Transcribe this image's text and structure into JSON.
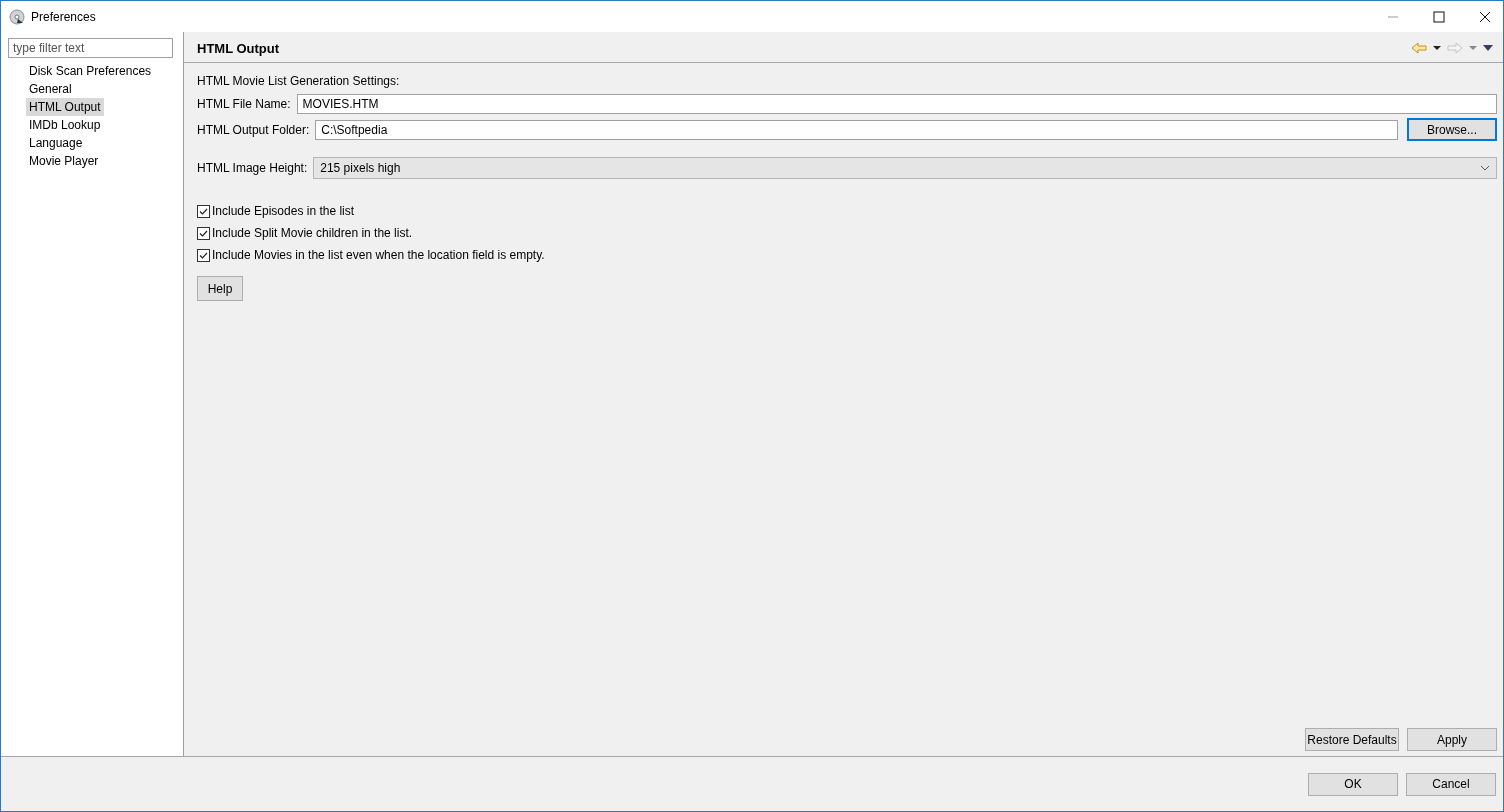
{
  "window": {
    "title": "Preferences"
  },
  "sidebar": {
    "filter": {
      "placeholder": "type filter text"
    },
    "items": [
      {
        "label": "Disk Scan Preferences",
        "selected": false
      },
      {
        "label": "General",
        "selected": false
      },
      {
        "label": "HTML Output",
        "selected": true
      },
      {
        "label": "IMDb Lookup",
        "selected": false
      },
      {
        "label": "Language",
        "selected": false
      },
      {
        "label": "Movie Player",
        "selected": false
      }
    ]
  },
  "page": {
    "title": "HTML Output",
    "section_heading": "HTML Movie List Generation Settings:",
    "file_name": {
      "label": "HTML File Name:",
      "value": "MOVIES.HTM"
    },
    "output_folder": {
      "label": "HTML Output Folder:",
      "value": "C:\\Softpedia",
      "button": {
        "label": "Browse...",
        "focused": true
      }
    },
    "image_height": {
      "label": "HTML Image Height:",
      "value": "215 pixels high"
    },
    "checkboxes": [
      {
        "label": "Include Episodes in the list",
        "checked": true
      },
      {
        "label": "Include Split Movie children in the list.",
        "checked": true
      },
      {
        "label": "Include Movies in the list even when the location field is empty.",
        "checked": true
      }
    ],
    "help_button": "Help",
    "page_buttons": [
      "Restore Defaults",
      "Apply"
    ]
  },
  "dialog_buttons": [
    "OK",
    "Cancel"
  ]
}
